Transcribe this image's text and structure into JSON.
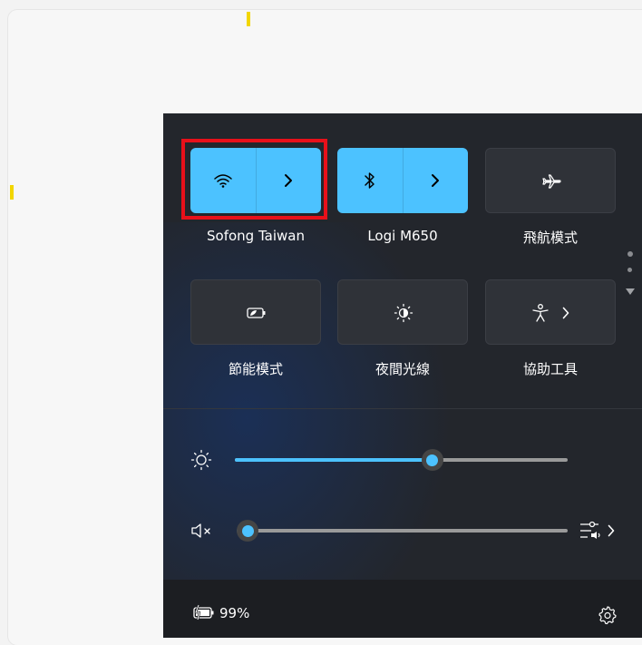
{
  "colors": {
    "accent": "#4cc2ff",
    "panel_bg": "#23262c",
    "tile_off_bg": "#2f3238",
    "highlight_border": "#e8101a",
    "marker": "#f2d600"
  },
  "quick_settings": {
    "tiles": [
      {
        "label": "Sofong Taiwan",
        "icon": "wifi-icon",
        "state": "on",
        "has_chevron": true
      },
      {
        "label": "Logi M650",
        "icon": "bluetooth-icon",
        "state": "on",
        "has_chevron": true
      },
      {
        "label": "飛航模式",
        "icon": "airplane-icon",
        "state": "off",
        "has_chevron": false
      },
      {
        "label": "節能模式",
        "icon": "energy-saver-icon",
        "state": "off",
        "has_chevron": false
      },
      {
        "label": "夜間光線",
        "icon": "night-light-icon",
        "state": "off",
        "has_chevron": false
      },
      {
        "label": "協助工具",
        "icon": "accessibility-icon",
        "state": "off",
        "has_chevron": true
      }
    ],
    "pager": {
      "pages": 2,
      "current_page": 1
    },
    "brightness": {
      "icon": "brightness-icon",
      "value": 0.6
    },
    "volume": {
      "icon": "volume-muted-icon",
      "value": 0.0,
      "mixer_icon": "audio-mixer-icon"
    },
    "footer": {
      "battery_icon": "battery-charging-icon",
      "battery_text": "99%",
      "settings_icon": "gear-icon"
    }
  }
}
